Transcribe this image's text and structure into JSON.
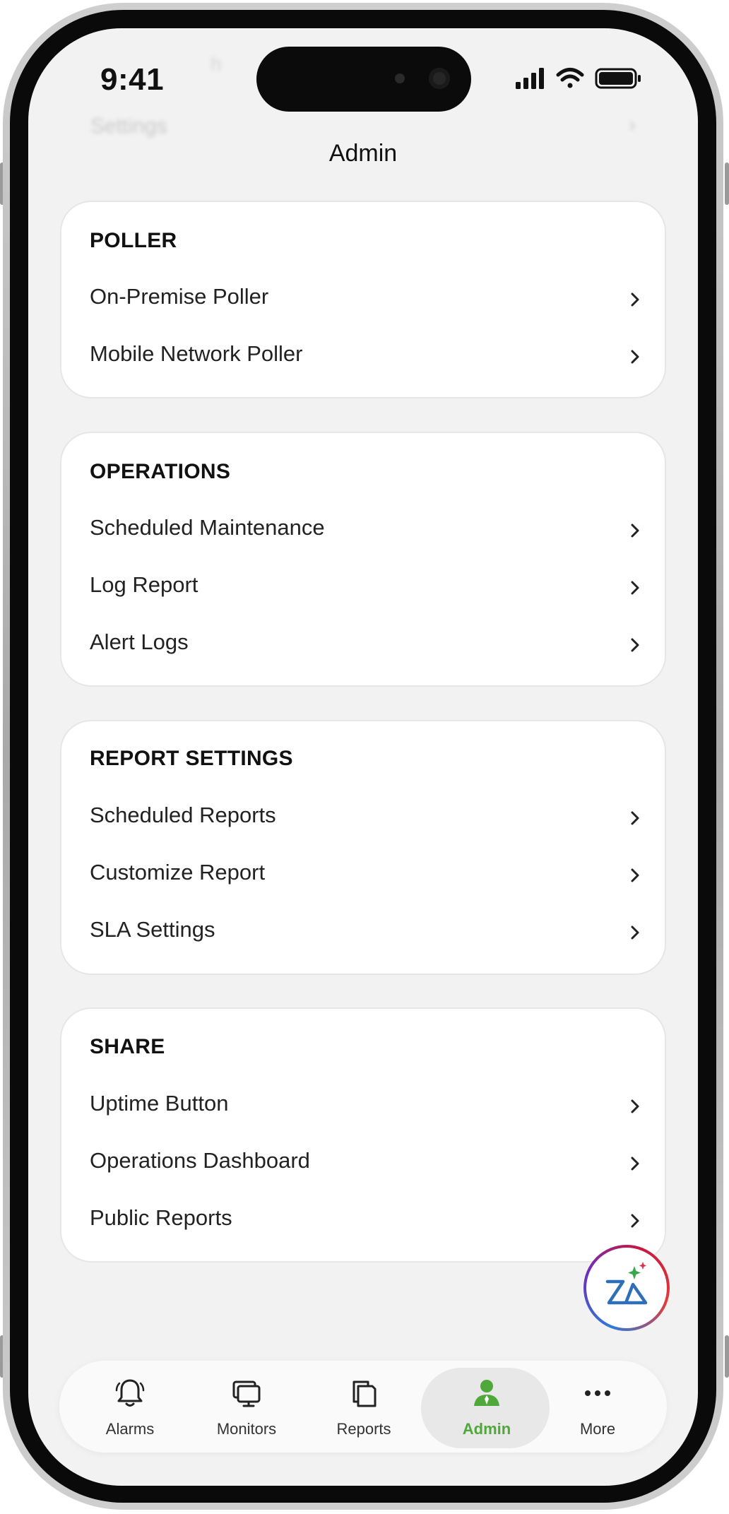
{
  "status_bar": {
    "time": "9:41"
  },
  "header": {
    "title": "Admin"
  },
  "ghost": {
    "top_label": "h",
    "row_label": "Settings"
  },
  "sections": [
    {
      "title": "POLLER",
      "items": [
        {
          "label": "On-Premise Poller"
        },
        {
          "label": "Mobile Network Poller"
        }
      ]
    },
    {
      "title": "OPERATIONS",
      "items": [
        {
          "label": "Scheduled Maintenance"
        },
        {
          "label": "Log Report"
        },
        {
          "label": "Alert Logs"
        }
      ]
    },
    {
      "title": "REPORT SETTINGS",
      "items": [
        {
          "label": "Scheduled Reports"
        },
        {
          "label": "Customize Report"
        },
        {
          "label": "SLA Settings"
        }
      ]
    },
    {
      "title": "SHARE",
      "items": [
        {
          "label": "Uptime Button"
        },
        {
          "label": "Operations Dashboard"
        },
        {
          "label": "Public Reports"
        }
      ]
    }
  ],
  "fab": {
    "icon": "zia-assistant-icon"
  },
  "tabbar": {
    "active": "Admin",
    "accent_color": "#4fa83a",
    "tabs": [
      {
        "label": "Alarms",
        "icon": "bell-icon"
      },
      {
        "label": "Monitors",
        "icon": "monitor-icon"
      },
      {
        "label": "Reports",
        "icon": "document-icon"
      },
      {
        "label": "Admin",
        "icon": "admin-user-icon"
      },
      {
        "label": "More",
        "icon": "more-dots-icon"
      }
    ]
  }
}
